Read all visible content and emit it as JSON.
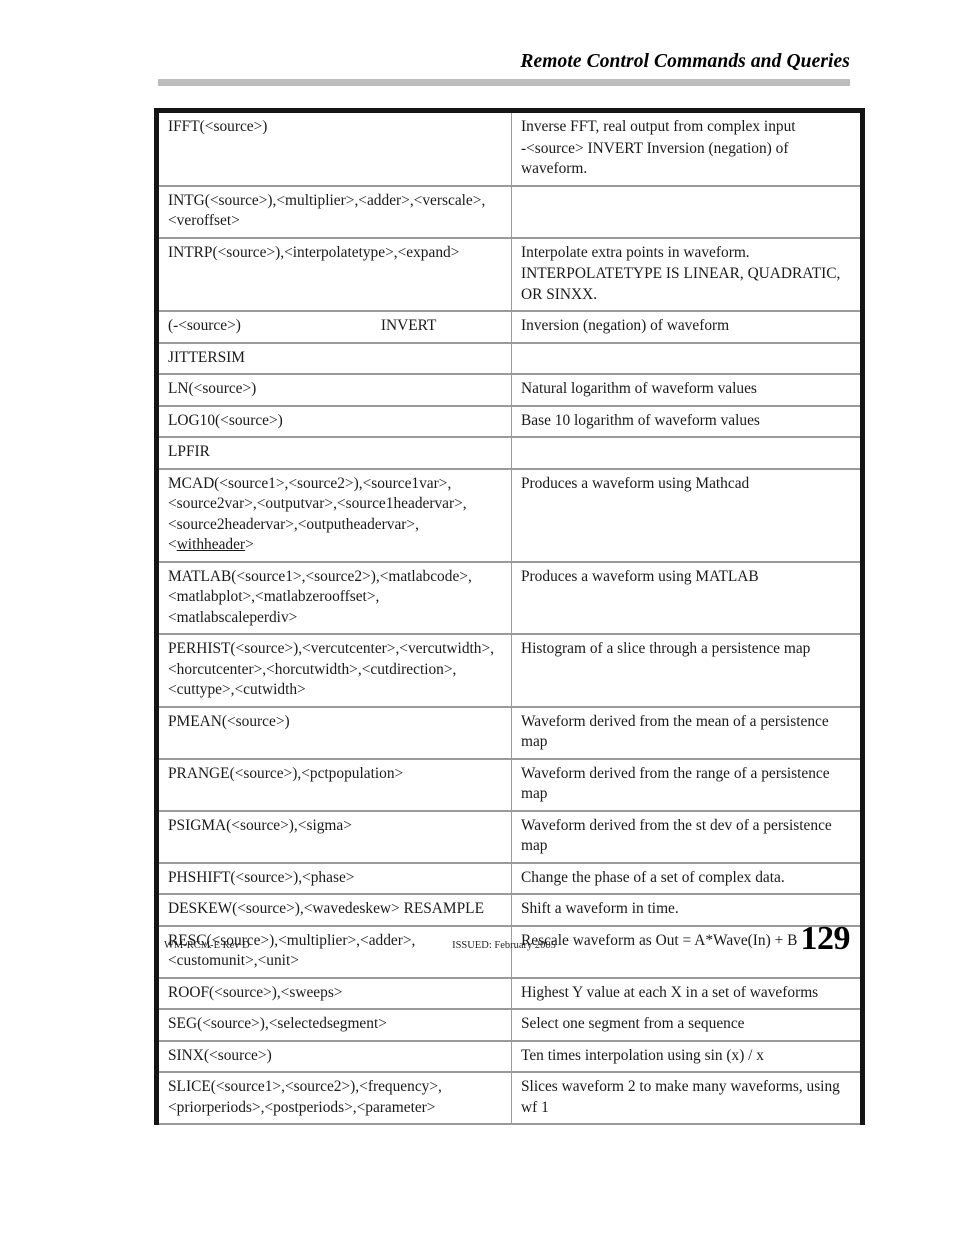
{
  "header": {
    "title": "Remote Control Commands and Queries"
  },
  "table": {
    "rows": [
      {
        "syntax": [
          "IFFT(<source>)"
        ],
        "desc": [
          "Inverse FFT, real output from complex input",
          "-<source> INVERT Inversion (negation) of waveform."
        ]
      },
      {
        "syntax": [
          "INTG(<source>),<multiplier>,<adder>,<verscale>,<veroffset>"
        ],
        "desc": [
          ""
        ]
      },
      {
        "syntax": [
          "INTRP(<source>),<interpolatetype>,<expand>"
        ],
        "desc": [
          "Interpolate extra points in waveform.",
          "INTERPOLATETYPE IS LINEAR, QUADRATIC, OR SINXX."
        ]
      },
      {
        "syntax_left": "(-<source>)",
        "syntax_right": "INVERT",
        "desc": [
          "Inversion (negation) of waveform"
        ]
      },
      {
        "syntax": [
          "JITTERSIM"
        ],
        "desc": [
          ""
        ]
      },
      {
        "syntax": [
          "LN(<source>)"
        ],
        "desc": [
          "Natural logarithm of waveform values"
        ]
      },
      {
        "syntax": [
          "LOG10(<source>)"
        ],
        "desc": [
          "Base 10 logarithm of waveform values"
        ]
      },
      {
        "syntax": [
          "LPFIR"
        ],
        "desc": [
          ""
        ]
      },
      {
        "syntax_pre": "MCAD(<source1>,<source2>),<source1var>,<source2var>,<outputvar>,<source1headervar>,<source2headervar>,<outputheadervar>,<",
        "syntax_underlined": "withheader",
        "syntax_post": ">",
        "desc": [
          "Produces a waveform using Mathcad"
        ]
      },
      {
        "syntax": [
          "MATLAB(<source1>,<source2>),<matlabcode>,<matlabplot>,<matlabzerooffset>,<matlabscaleperdiv>"
        ],
        "desc": [
          "Produces a waveform using MATLAB"
        ]
      },
      {
        "syntax": [
          "PERHIST(<source>),<vercutcenter>,<vercutwidth>,<horcutcenter>,<horcutwidth>,<cutdirection>,<cuttype>,<cutwidth>"
        ],
        "desc": [
          "Histogram of a slice through a persistence map"
        ]
      },
      {
        "syntax": [
          "PMEAN(<source>)"
        ],
        "desc": [
          "Waveform derived from the mean of a persistence map"
        ]
      },
      {
        "syntax": [
          "PRANGE(<source>),<pctpopulation>"
        ],
        "desc": [
          "Waveform derived from the range of a persistence map"
        ]
      },
      {
        "syntax": [
          "PSIGMA(<source>),<sigma>"
        ],
        "desc": [
          "Waveform derived from the st dev of a persistence map"
        ]
      },
      {
        "syntax": [
          "PHSHIFT(<source>),<phase>"
        ],
        "desc": [
          "Change the phase of a set of complex data."
        ]
      },
      {
        "syntax": [
          "DESKEW(<source>),<wavedeskew> RESAMPLE"
        ],
        "desc": [
          "Shift a waveform in time."
        ]
      },
      {
        "syntax": [
          "RESC(<source>),<multiplier>,<adder>,<customunit>,<unit>"
        ],
        "desc": [
          "Rescale waveform as Out = A*Wave(In) + B"
        ]
      },
      {
        "syntax": [
          "ROOF(<source>),<sweeps>"
        ],
        "desc": [
          "Highest Y value at each X in a set of waveforms"
        ]
      },
      {
        "syntax": [
          "SEG(<source>),<selectedsegment>"
        ],
        "desc": [
          "Select one segment from a sequence"
        ]
      },
      {
        "syntax": [
          "SINX(<source>)"
        ],
        "desc": [
          "Ten times interpolation using sin (x) / x"
        ]
      },
      {
        "syntax": [
          "SLICE(<source1>,<source2>),<frequency>,<priorperiods>,<postperiods>,<parameter>"
        ],
        "desc": [
          "Slices waveform 2 to make many waveforms, using wf 1"
        ]
      }
    ]
  },
  "footer": {
    "doc_id": "WM-RCM-E Rev D",
    "issued": "ISSUED: February 2005",
    "page_number": "129"
  }
}
